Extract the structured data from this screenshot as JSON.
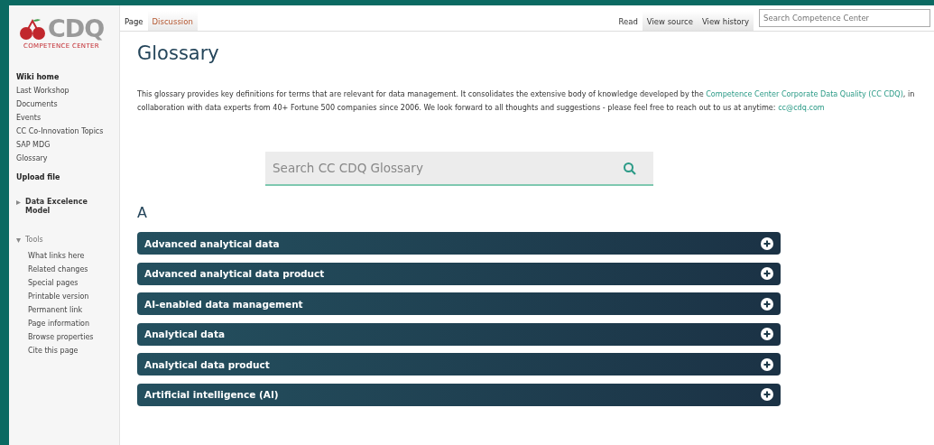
{
  "logo": {
    "name": "CDQ",
    "tagline": "COMPETENCE CENTER"
  },
  "sidebar": {
    "navigation": [
      {
        "label": "Wiki home",
        "kind": "heading"
      },
      {
        "label": "Last Workshop",
        "kind": "link"
      },
      {
        "label": "Documents",
        "kind": "link"
      },
      {
        "label": "Events",
        "kind": "link"
      },
      {
        "label": "CC Co-Innovation Topics",
        "kind": "link"
      },
      {
        "label": "SAP MDG",
        "kind": "link"
      },
      {
        "label": "Glossary",
        "kind": "link"
      }
    ],
    "upload": "Upload file",
    "portlets": [
      {
        "label": "Data Excelence Model",
        "expanded": false
      },
      {
        "label": "Tools",
        "expanded": true,
        "items": [
          "What links here",
          "Related changes",
          "Special pages",
          "Printable version",
          "Permanent link",
          "Page information",
          "Browse properties",
          "Cite this page"
        ]
      }
    ]
  },
  "namespace_tabs": [
    {
      "label": "Page",
      "selected": true
    },
    {
      "label": "Discussion",
      "selected": false
    }
  ],
  "view_tabs": [
    {
      "label": "Read",
      "selected": true
    },
    {
      "label": "View source",
      "selected": false
    },
    {
      "label": "View history",
      "selected": false
    }
  ],
  "site_search": {
    "placeholder": "Search Competence Center"
  },
  "page": {
    "title": "Glossary",
    "intro_before": "This glossary provides key definitions for terms that are relevant for data management. It consolidates the extensive body of knowledge developed by the",
    "intro_link": "Competence Center Corporate Data Quality (CC CDQ)",
    "intro_middle": ", in collaboration with data experts from 40+ Fortune 500 companies since 2006. We look forward to all thoughts and suggestions - please feel free to reach out to us at anytime:",
    "intro_email": "cc@cdq.com",
    "glossary_search": {
      "placeholder": "Search CC CDQ Glossary"
    },
    "sections": [
      {
        "letter": "A",
        "terms": [
          {
            "label": "Advanced analytical data",
            "expanded": false
          },
          {
            "label": "Advanced analytical data product",
            "expanded": false
          },
          {
            "label": "AI-enabled data management",
            "expanded": false
          },
          {
            "label": "Analytical data",
            "expanded": false
          },
          {
            "label": "Analytical data product",
            "expanded": false
          },
          {
            "label": "Artificial intelligence (AI)",
            "expanded": false
          }
        ]
      }
    ]
  }
}
